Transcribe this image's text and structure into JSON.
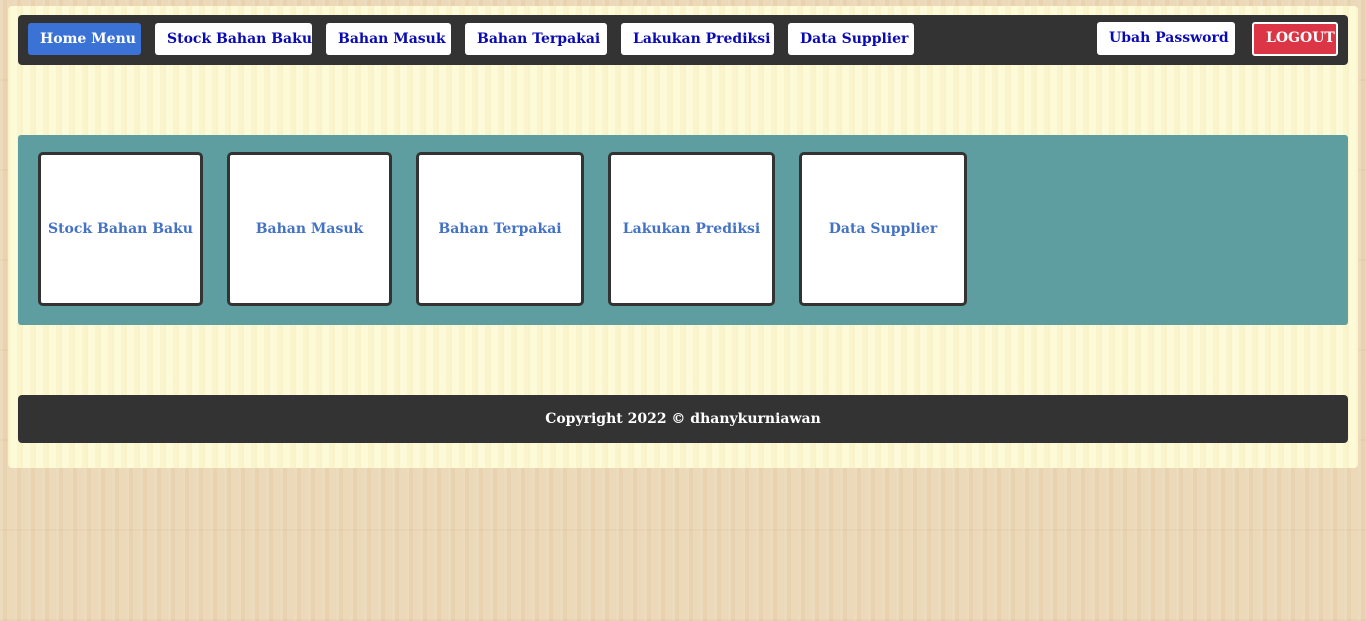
{
  "navbar": {
    "home_label": "Home Menu",
    "stock_label": "Stock Bahan Baku",
    "masuk_label": "Bahan Masuk",
    "terpakai_label": "Bahan Terpakai",
    "prediksi_label": "Lakukan Prediksi",
    "supplier_label": "Data Supplier",
    "password_label": "Ubah Password",
    "logout_label": "LOGOUT"
  },
  "menu": {
    "cards": [
      {
        "label": "Stock Bahan Baku"
      },
      {
        "label": "Bahan Masuk"
      },
      {
        "label": "Bahan Terpakai"
      },
      {
        "label": "Lakukan Prediksi"
      },
      {
        "label": "Data Supplier"
      }
    ]
  },
  "footer": {
    "copyright": "Copyright 2022 © dhanykurniawan"
  },
  "colors": {
    "navbar_bg": "#333333",
    "active_button": "#3b72d6",
    "logout_button": "#dc3545",
    "panel_bg": "#5f9ea0",
    "card_text": "#4472c4",
    "nav_text": "#0a0ab4"
  }
}
